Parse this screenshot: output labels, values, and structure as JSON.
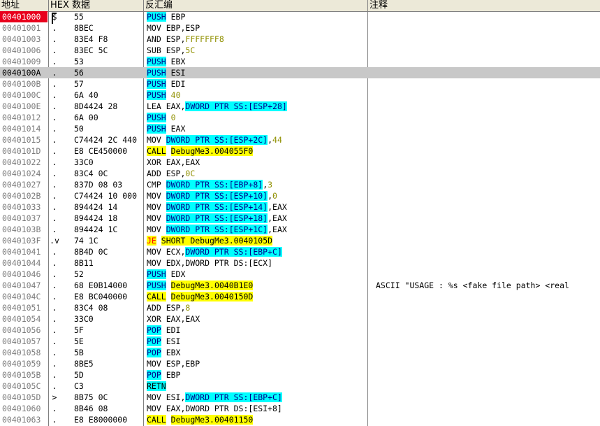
{
  "columns": {
    "address": "地址",
    "hex": "HEX 数据",
    "disasm": "反汇编",
    "comment": "注释"
  },
  "rows": [
    {
      "addr": "00401000",
      "mark": "$",
      "hex": "55",
      "asm": [
        [
          "PUSH",
          "push"
        ],
        [
          " EBP",
          ""
        ]
      ],
      "cmt": ""
    },
    {
      "addr": "00401001",
      "mark": ".",
      "hex": "8BEC",
      "asm": [
        [
          "MOV EBP,ESP",
          ""
        ]
      ],
      "cmt": ""
    },
    {
      "addr": "00401003",
      "mark": ".",
      "hex": "83E4 F8",
      "asm": [
        [
          "AND ESP,",
          ""
        ],
        [
          "FFFFFFF8",
          "num"
        ]
      ],
      "cmt": ""
    },
    {
      "addr": "00401006",
      "mark": ".",
      "hex": "83EC 5C",
      "asm": [
        [
          "SUB ESP,",
          ""
        ],
        [
          "5C",
          "num"
        ]
      ],
      "cmt": ""
    },
    {
      "addr": "00401009",
      "mark": ".",
      "hex": "53",
      "asm": [
        [
          "PUSH",
          "push"
        ],
        [
          " EBX",
          ""
        ]
      ],
      "cmt": ""
    },
    {
      "addr": "0040100A",
      "mark": ".",
      "hex": "56",
      "asm": [
        [
          "PUSH",
          "push"
        ],
        [
          " ESI",
          ""
        ]
      ],
      "cmt": ""
    },
    {
      "addr": "0040100B",
      "mark": ".",
      "hex": "57",
      "asm": [
        [
          "PUSH",
          "push"
        ],
        [
          " EDI",
          ""
        ]
      ],
      "cmt": ""
    },
    {
      "addr": "0040100C",
      "mark": ".",
      "hex": "6A 40",
      "asm": [
        [
          "PUSH",
          "push"
        ],
        [
          " ",
          ""
        ],
        [
          "40",
          "num"
        ]
      ],
      "cmt": ""
    },
    {
      "addr": "0040100E",
      "mark": ".",
      "hex": "8D4424 28",
      "asm": [
        [
          "LEA EAX,",
          ""
        ],
        [
          "DWORD PTR SS:[ESP+28]",
          "ptr"
        ]
      ],
      "cmt": ""
    },
    {
      "addr": "00401012",
      "mark": ".",
      "hex": "6A 00",
      "asm": [
        [
          "PUSH",
          "push"
        ],
        [
          " ",
          ""
        ],
        [
          "0",
          "num"
        ]
      ],
      "cmt": ""
    },
    {
      "addr": "00401014",
      "mark": ".",
      "hex": "50",
      "asm": [
        [
          "PUSH",
          "push"
        ],
        [
          " EAX",
          ""
        ]
      ],
      "cmt": ""
    },
    {
      "addr": "00401015",
      "mark": ".",
      "hex": "C74424 2C 440",
      "asm": [
        [
          "MOV ",
          ""
        ],
        [
          "DWORD PTR SS:[ESP+2C]",
          "ptr"
        ],
        [
          ",",
          ""
        ],
        [
          "44",
          "num"
        ]
      ],
      "cmt": ""
    },
    {
      "addr": "0040101D",
      "mark": ".",
      "hex": "E8 CE450000",
      "asm": [
        [
          "CALL",
          "call"
        ],
        [
          " ",
          ""
        ],
        [
          "DebugMe3.004055F0",
          "tgt"
        ]
      ],
      "cmt": ""
    },
    {
      "addr": "00401022",
      "mark": ".",
      "hex": "33C0",
      "asm": [
        [
          "XOR EAX,EAX",
          ""
        ]
      ],
      "cmt": ""
    },
    {
      "addr": "00401024",
      "mark": ".",
      "hex": "83C4 0C",
      "asm": [
        [
          "ADD ESP,",
          ""
        ],
        [
          "0C",
          "num"
        ]
      ],
      "cmt": ""
    },
    {
      "addr": "00401027",
      "mark": ".",
      "hex": "837D 08 03",
      "asm": [
        [
          "CMP ",
          ""
        ],
        [
          "DWORD PTR SS:[EBP+8]",
          "ptr"
        ],
        [
          ",",
          ""
        ],
        [
          "3",
          "num"
        ]
      ],
      "cmt": ""
    },
    {
      "addr": "0040102B",
      "mark": ".",
      "hex": "C74424 10 000",
      "asm": [
        [
          "MOV ",
          ""
        ],
        [
          "DWORD PTR SS:[ESP+10]",
          "ptr"
        ],
        [
          ",",
          ""
        ],
        [
          "0",
          "num"
        ]
      ],
      "cmt": ""
    },
    {
      "addr": "00401033",
      "mark": ".",
      "hex": "894424 14",
      "asm": [
        [
          "MOV ",
          ""
        ],
        [
          "DWORD PTR SS:[ESP+14]",
          "ptr"
        ],
        [
          ",EAX",
          ""
        ]
      ],
      "cmt": ""
    },
    {
      "addr": "00401037",
      "mark": ".",
      "hex": "894424 18",
      "asm": [
        [
          "MOV ",
          ""
        ],
        [
          "DWORD PTR SS:[ESP+18]",
          "ptr"
        ],
        [
          ",EAX",
          ""
        ]
      ],
      "cmt": ""
    },
    {
      "addr": "0040103B",
      "mark": ".",
      "hex": "894424 1C",
      "asm": [
        [
          "MOV ",
          ""
        ],
        [
          "DWORD PTR SS:[ESP+1C]",
          "ptr"
        ],
        [
          ",EAX",
          ""
        ]
      ],
      "cmt": ""
    },
    {
      "addr": "0040103F",
      "mark": ".v",
      "hex": "74 1C",
      "asm": [
        [
          "JE",
          "jmp"
        ],
        [
          " ",
          ""
        ],
        [
          "SHORT DebugMe3.0040105D",
          "tgt"
        ]
      ],
      "cmt": ""
    },
    {
      "addr": "00401041",
      "mark": ".",
      "hex": "8B4D 0C",
      "asm": [
        [
          "MOV ECX,",
          ""
        ],
        [
          "DWORD PTR SS:[EBP+C]",
          "ptr"
        ]
      ],
      "cmt": ""
    },
    {
      "addr": "00401044",
      "mark": ".",
      "hex": "8B11",
      "asm": [
        [
          "MOV EDX,DWORD PTR DS:[ECX]",
          ""
        ]
      ],
      "cmt": ""
    },
    {
      "addr": "00401046",
      "mark": ".",
      "hex": "52",
      "asm": [
        [
          "PUSH",
          "push"
        ],
        [
          " EDX",
          ""
        ]
      ],
      "cmt": ""
    },
    {
      "addr": "00401047",
      "mark": ".",
      "hex": "68 E0B14000",
      "asm": [
        [
          "PUSH",
          "push"
        ],
        [
          " ",
          ""
        ],
        [
          "DebugMe3.0040B1E0",
          "tgt"
        ]
      ],
      "cmt": "ASCII \"USAGE : %s <fake file path> <real"
    },
    {
      "addr": "0040104C",
      "mark": ".",
      "hex": "E8 BC040000",
      "asm": [
        [
          "CALL",
          "call"
        ],
        [
          " ",
          ""
        ],
        [
          "DebugMe3.0040150D",
          "tgt"
        ]
      ],
      "cmt": ""
    },
    {
      "addr": "00401051",
      "mark": ".",
      "hex": "83C4 08",
      "asm": [
        [
          "ADD ESP,",
          ""
        ],
        [
          "8",
          "num"
        ]
      ],
      "cmt": ""
    },
    {
      "addr": "00401054",
      "mark": ".",
      "hex": "33C0",
      "asm": [
        [
          "XOR EAX,EAX",
          ""
        ]
      ],
      "cmt": ""
    },
    {
      "addr": "00401056",
      "mark": ".",
      "hex": "5F",
      "asm": [
        [
          "POP",
          "push"
        ],
        [
          " EDI",
          ""
        ]
      ],
      "cmt": ""
    },
    {
      "addr": "00401057",
      "mark": ".",
      "hex": "5E",
      "asm": [
        [
          "POP",
          "push"
        ],
        [
          " ESI",
          ""
        ]
      ],
      "cmt": ""
    },
    {
      "addr": "00401058",
      "mark": ".",
      "hex": "5B",
      "asm": [
        [
          "POP",
          "push"
        ],
        [
          " EBX",
          ""
        ]
      ],
      "cmt": ""
    },
    {
      "addr": "00401059",
      "mark": ".",
      "hex": "8BE5",
      "asm": [
        [
          "MOV ESP,EBP",
          ""
        ]
      ],
      "cmt": ""
    },
    {
      "addr": "0040105B",
      "mark": ".",
      "hex": "5D",
      "asm": [
        [
          "POP",
          "push"
        ],
        [
          " EBP",
          ""
        ]
      ],
      "cmt": ""
    },
    {
      "addr": "0040105C",
      "mark": ".",
      "hex": "C3",
      "asm": [
        [
          "RETN",
          "ret"
        ]
      ],
      "cmt": ""
    },
    {
      "addr": "0040105D",
      "mark": ">",
      "hex": "8B75 0C",
      "asm": [
        [
          "MOV ESI,",
          ""
        ],
        [
          "DWORD PTR SS:[EBP+C]",
          "ptr"
        ]
      ],
      "cmt": ""
    },
    {
      "addr": "00401060",
      "mark": ".",
      "hex": "8B46 08",
      "asm": [
        [
          "MOV EAX,DWORD PTR DS:[ESI+8]",
          ""
        ]
      ],
      "cmt": ""
    },
    {
      "addr": "00401063",
      "mark": ".",
      "hex": "E8 E8000000",
      "asm": [
        [
          "CALL",
          "call"
        ],
        [
          " ",
          ""
        ],
        [
          "DebugMe3.00401150",
          "tgt"
        ]
      ],
      "cmt": ""
    }
  ],
  "current_index": 0,
  "selected_index": 5,
  "colors": {
    "current_eip_bg": "#e8001c",
    "selected_row_bg": "#c8c8c8",
    "highlight_cyan": "#00ffff",
    "highlight_yellow": "#ffff00",
    "jump_red": "#ff0000",
    "immediate_olive": "#909000"
  }
}
